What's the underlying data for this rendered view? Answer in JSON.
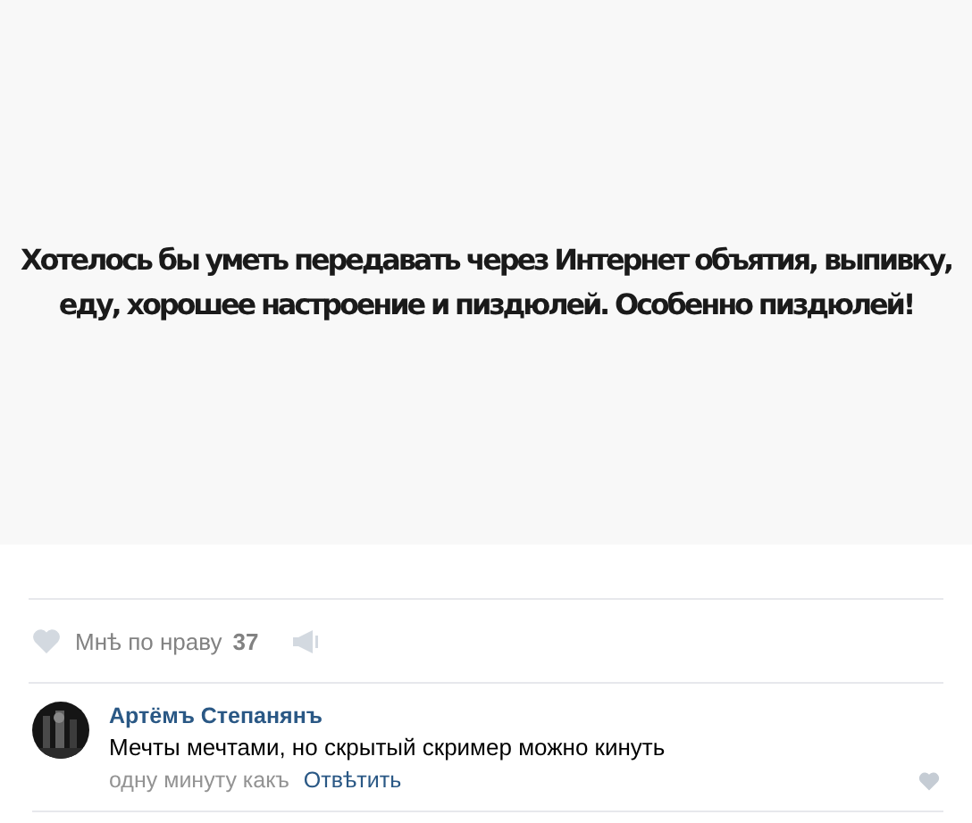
{
  "post": {
    "image_lines": [
      "Хотелось бы уметь передавать через Интернет объятия, выпивку,",
      "еду, хорошее настроение и пиздюлей. Особенно пиздюлей!"
    ],
    "like_label": "Мнѣ по нраву",
    "like_count": "37"
  },
  "comment": {
    "author": "Артёмъ Степанянъ",
    "text": "Мечты мечтами, но скрытый скример можно кинуть",
    "time": "одну минуту какъ",
    "reply": "Отвѣтить"
  }
}
